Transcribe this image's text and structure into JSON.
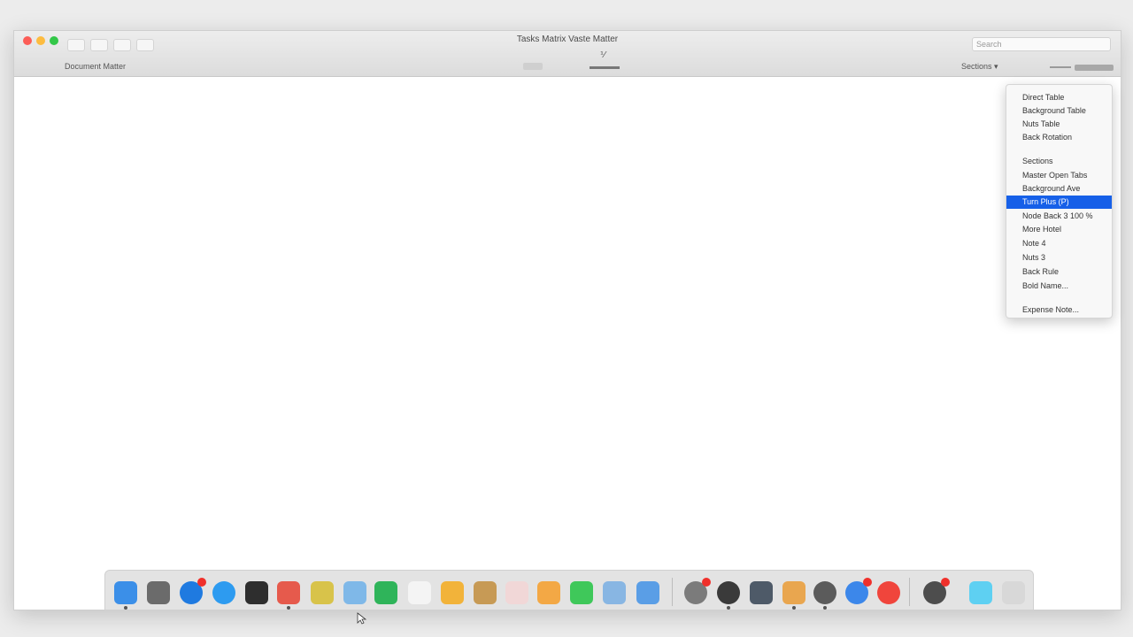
{
  "window": {
    "title": "Tasks Matrix Vaste Matter",
    "subtitle_left": "Document Matter",
    "search_placeholder": "Search",
    "right_label": "Sections ▾",
    "tool_b_glyph": "⅟"
  },
  "menu": {
    "items": [
      {
        "label": "Direct Table"
      },
      {
        "label": "Background Table"
      },
      {
        "label": "Nuts Table"
      },
      {
        "label": "Back Rotation"
      },
      {
        "label": "Sections"
      },
      {
        "label": "Master Open Tabs"
      },
      {
        "label": "Background Ave"
      },
      {
        "label": "Turn Plus (P)"
      },
      {
        "label": "Node Back 3  100 %"
      },
      {
        "label": "More Hotel"
      },
      {
        "label": "Note 4"
      },
      {
        "label": "Nuts 3"
      },
      {
        "label": "Back Rule"
      },
      {
        "label": "Bold Name..."
      },
      {
        "label": "Expense Note..."
      }
    ],
    "selected_index": 7,
    "accent_color": "#1660e8"
  },
  "dock": {
    "icons": [
      {
        "name": "finder-icon",
        "color": "#3b8fe8"
      },
      {
        "name": "launchpad-icon",
        "color": "#6b6b6b"
      },
      {
        "name": "safari-icon",
        "color": "#1f7ae0"
      },
      {
        "name": "app-store-icon",
        "color": "#2d9bf0"
      },
      {
        "name": "terminal-icon",
        "color": "#2e2e2e"
      },
      {
        "name": "calendar-icon",
        "color": "#e65a4c"
      },
      {
        "name": "notes-icon",
        "color": "#d8c34a"
      },
      {
        "name": "preview-icon",
        "color": "#7fb8e8"
      },
      {
        "name": "numbers-icon",
        "color": "#2fb45a"
      },
      {
        "name": "textedit-icon",
        "color": "#f4f4f4"
      },
      {
        "name": "pages-icon",
        "color": "#f2b33a"
      },
      {
        "name": "contacts-icon",
        "color": "#c79a55"
      },
      {
        "name": "reminders-icon",
        "color": "#f1d7d7"
      },
      {
        "name": "photos-icon",
        "color": "#f3a845"
      },
      {
        "name": "messages-icon",
        "color": "#3fc85a"
      },
      {
        "name": "keynote-icon",
        "color": "#88b6e3"
      },
      {
        "name": "mail-icon",
        "color": "#5a9ee6"
      },
      {
        "name": "system-preferences-icon",
        "color": "#7b7b7b"
      },
      {
        "name": "activity-icon",
        "color": "#3a3a3a"
      },
      {
        "name": "automator-icon",
        "color": "#4e5a68"
      },
      {
        "name": "color-picker-icon",
        "color": "#e9a64f"
      },
      {
        "name": "disk-utility-icon",
        "color": "#5b5b5b"
      },
      {
        "name": "photo-booth-icon",
        "color": "#3c87ea"
      },
      {
        "name": "music-icon",
        "color": "#f0453c"
      },
      {
        "name": "trash-utility-icon",
        "color": "#4d4d4d"
      },
      {
        "name": "downloads-folder-icon",
        "color": "#5ed0f2"
      },
      {
        "name": "trash-icon",
        "color": "#d8d8d8"
      }
    ]
  }
}
